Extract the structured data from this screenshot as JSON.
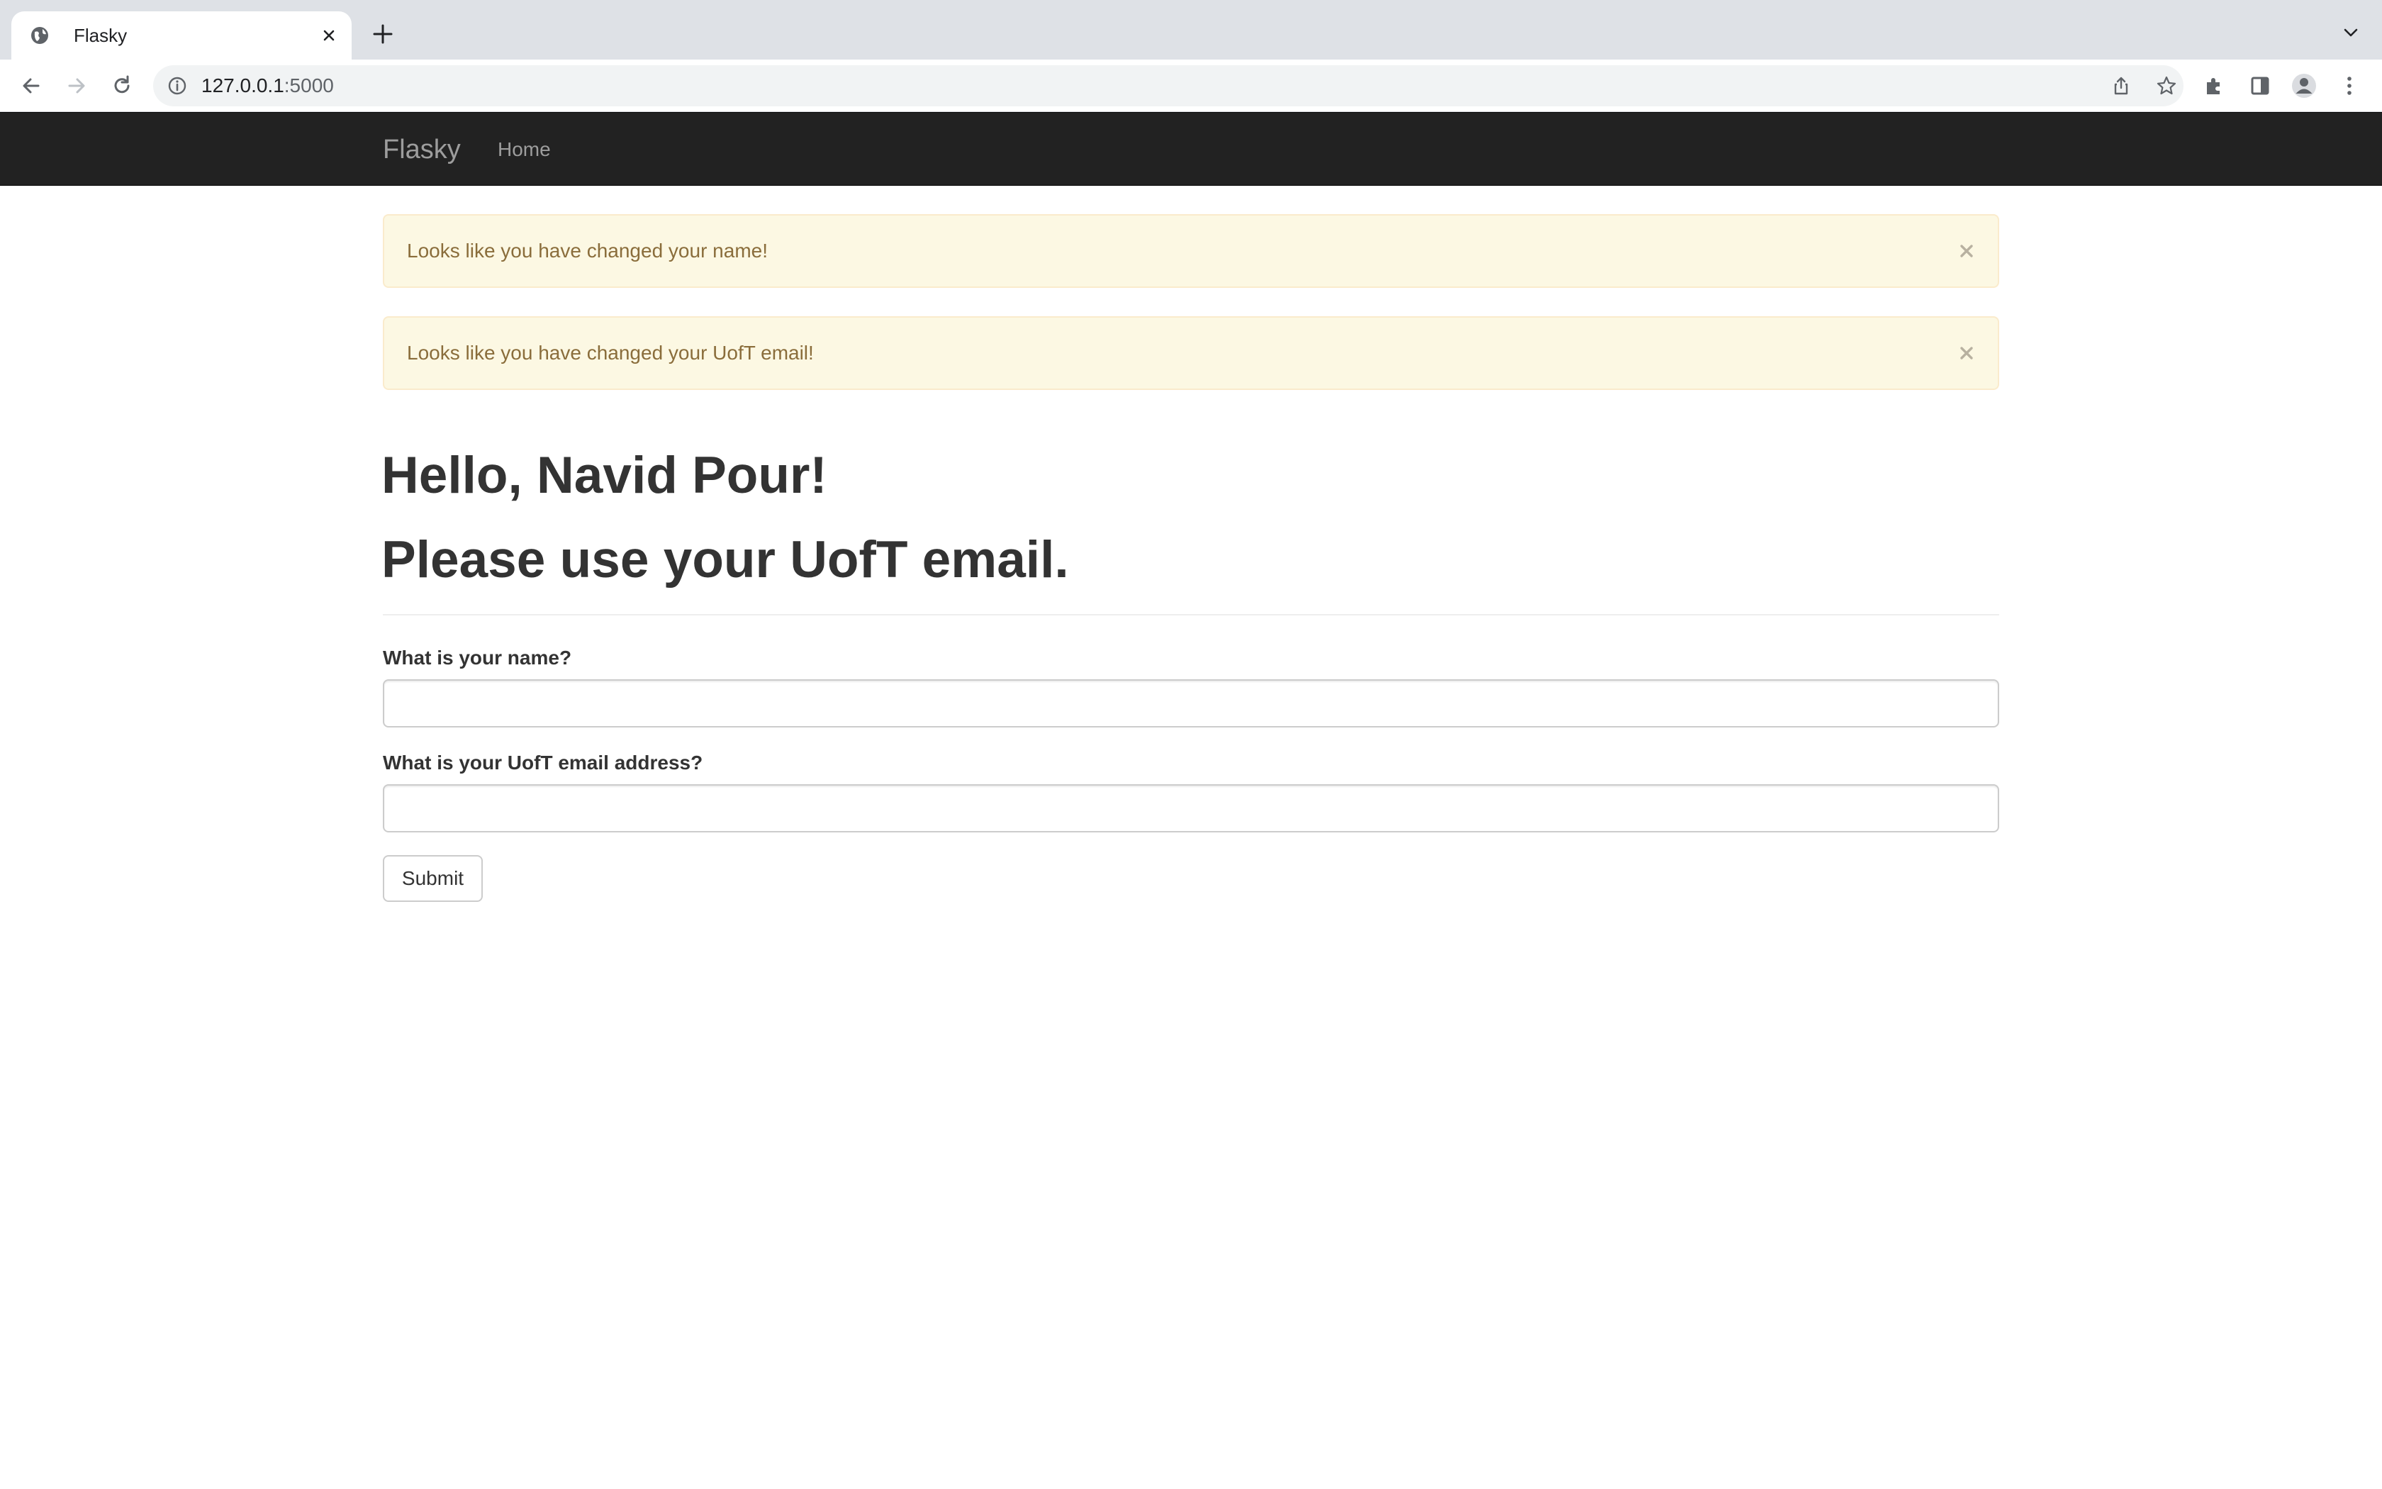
{
  "browser": {
    "tab_title": "Flasky",
    "url_host": "127.0.0.1",
    "url_port": ":5000",
    "colors": {
      "tabstrip": "#dee1e6",
      "omnibox": "#f1f3f4"
    },
    "icons": {
      "favicon": "globe-icon",
      "tab_close": "close-icon",
      "new_tab": "plus-icon",
      "tab_search": "chevron-down-icon",
      "back": "arrow-left-icon",
      "forward": "arrow-right-icon",
      "reload": "reload-icon",
      "site_info": "info-icon",
      "share": "share-icon",
      "bookmark": "star-icon",
      "extensions": "puzzle-icon",
      "side_panel": "side-panel-icon",
      "profile": "profile-icon",
      "menu": "kebab-menu-icon"
    }
  },
  "navbar": {
    "brand": "Flasky",
    "home_link": "Home",
    "background": "#222222"
  },
  "alerts": [
    {
      "message": "Looks like you have changed your name!"
    },
    {
      "message": "Looks like you have changed your UofT email!"
    }
  ],
  "alert_colors": {
    "background": "#fcf8e3",
    "border": "#faebcc",
    "text": "#8a6d3b"
  },
  "page": {
    "greeting": "Hello, Navid Pour!",
    "subheading": "Please use your UofT email."
  },
  "form": {
    "name_label": "What is your name?",
    "name_value": "",
    "email_label": "What is your UofT email address?",
    "email_value": "",
    "submit_label": "Submit"
  }
}
